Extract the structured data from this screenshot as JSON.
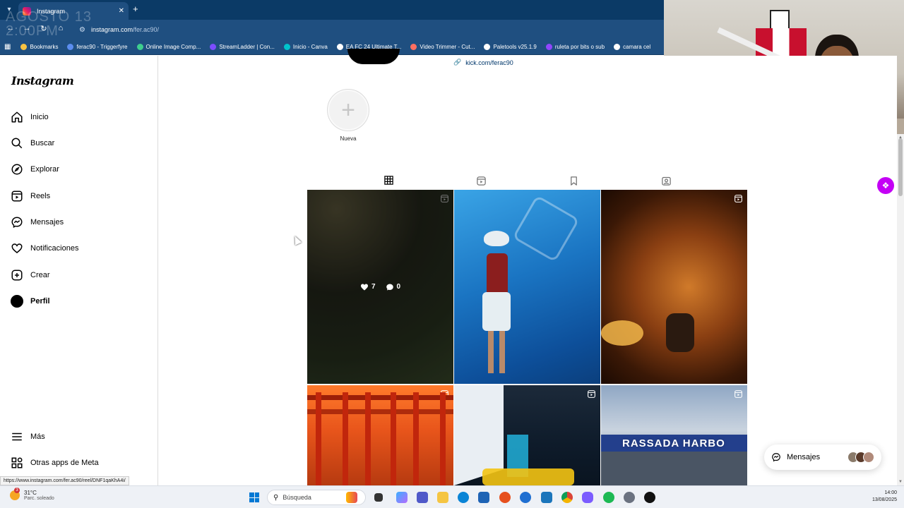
{
  "browser": {
    "tab_title": "Instagram",
    "new_tab_icon": "plus-icon",
    "url_prefix": "instagram.com",
    "url_path": "/fer.ac90/",
    "overlay_text_line1": "AGOSTO 13",
    "overlay_text_line2": "2:00PM",
    "bookmarks": [
      {
        "label": "Bookmarks",
        "color": "#f6c343"
      },
      {
        "label": "ferac90 - Triggerfyre",
        "color": "#5b8def"
      },
      {
        "label": "Online Image Comp...",
        "color": "#3ecf8e"
      },
      {
        "label": "StreamLadder | Con...",
        "color": "#7c4dff"
      },
      {
        "label": "Inicio - Canva",
        "color": "#00c4cc"
      },
      {
        "label": "EA FC 24 Ultimate T...",
        "color": "#ffffff"
      },
      {
        "label": "Video Trimmer - Cut...",
        "color": "#ff6f61"
      },
      {
        "label": "Paletools v25.1.9",
        "color": "#ffffff"
      },
      {
        "label": "ruleta por bits o sub",
        "color": "#9146ff"
      },
      {
        "label": "camara cel",
        "color": "#ffffff"
      }
    ]
  },
  "sidebar": {
    "logo": "Instagram",
    "items": [
      {
        "label": "Inicio",
        "icon": "home-icon"
      },
      {
        "label": "Buscar",
        "icon": "search-icon"
      },
      {
        "label": "Explorar",
        "icon": "compass-icon"
      },
      {
        "label": "Reels",
        "icon": "reels-icon"
      },
      {
        "label": "Mensajes",
        "icon": "messenger-icon"
      },
      {
        "label": "Notificaciones",
        "icon": "heart-icon"
      },
      {
        "label": "Crear",
        "icon": "plus-square-icon"
      },
      {
        "label": "Perfil",
        "icon": "avatar"
      }
    ],
    "more_label": "Más",
    "meta_label": "Otras apps de Meta"
  },
  "profile": {
    "bio_link": "kick.com/ferac90",
    "highlight_new_label": "Nueva"
  },
  "grid": {
    "post1_likes": "7",
    "post1_comments": "0",
    "post4_caption": "",
    "post6_sign": "RASSADA  HARBO"
  },
  "messages_pill": {
    "label": "Mensajes"
  },
  "status_url": "https://www.instagram.com/fer.ac90/reel/DNF1qaKhA4i/",
  "taskbar": {
    "weather_temp": "31°C",
    "weather_desc": "Parc. soleado",
    "weather_badge": "3",
    "search_placeholder": "Búsqueda",
    "time": "14:00",
    "date": "13/08/2025"
  },
  "colors": {
    "chrome_dark": "#0b3a66",
    "chrome": "#1f4f80",
    "link": "#00376b",
    "fab": "#c400f5"
  }
}
